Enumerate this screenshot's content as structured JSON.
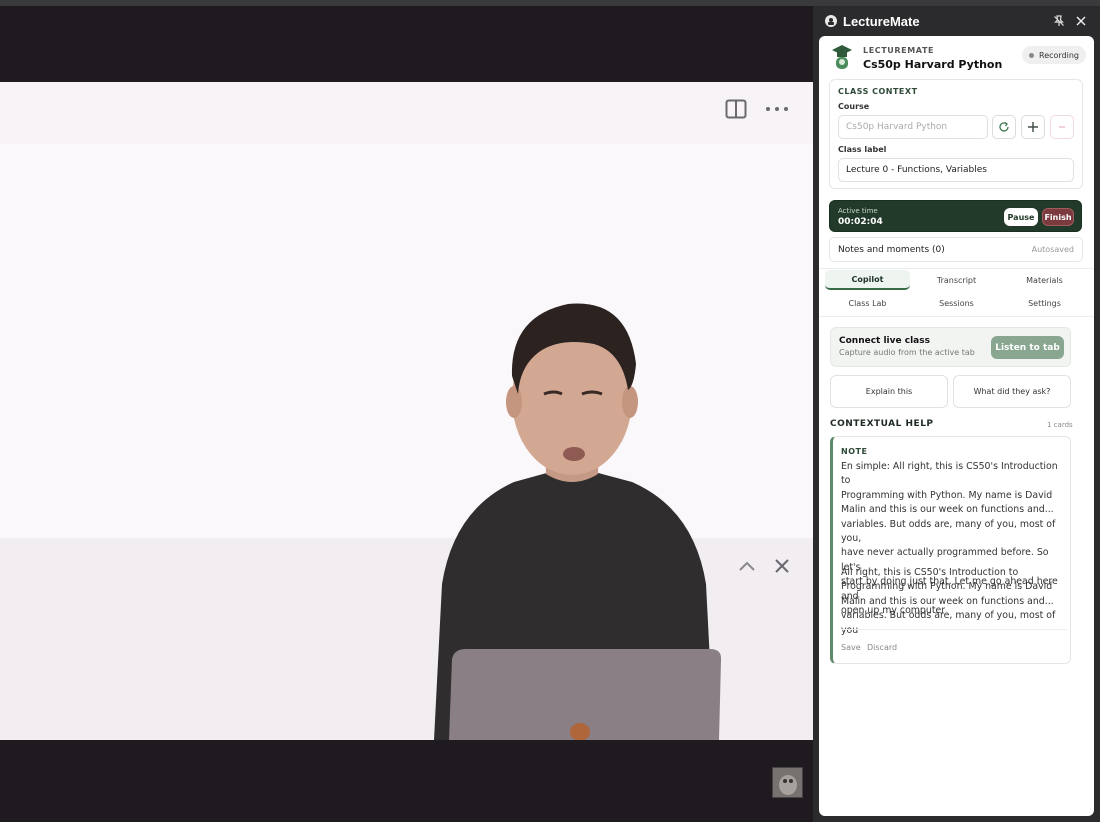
{
  "panel": {
    "app_title": "LectureMate",
    "pin_icon": "pin-off-icon",
    "close_icon": "close-icon"
  },
  "header": {
    "brand": "LECTUREMATE",
    "course_name": "Cs50p Harvard Python",
    "status": "Recording"
  },
  "class_context": {
    "section_title": "CLASS CONTEXT",
    "course_label": "Course",
    "course_placeholder": "Cs50p Harvard Python",
    "class_label_label": "Class label",
    "class_label_value": "Lecture 0 - Functions, Variables"
  },
  "timer": {
    "label": "Active time",
    "value": "00:02:04",
    "pause_label": "Pause",
    "finish_label": "Finish"
  },
  "notes": {
    "title": "Notes and moments (0)",
    "status": "Autosaved"
  },
  "tabs": [
    {
      "label": "Copilot",
      "active": true
    },
    {
      "label": "Transcript",
      "active": false
    },
    {
      "label": "Materials",
      "active": false
    },
    {
      "label": "Class Lab",
      "active": false
    },
    {
      "label": "Sessions",
      "active": false
    },
    {
      "label": "Settings",
      "active": false
    }
  ],
  "connect": {
    "title": "Connect live class",
    "subtitle": "Capture audio from the active tab",
    "button": "Listen to tab"
  },
  "quick_actions": {
    "explain": "Explain this",
    "what_asked": "What did they ask?"
  },
  "contextual_help": {
    "title": "CONTEXTUAL HELP",
    "count": "1 cards",
    "card": {
      "kind": "NOTE",
      "p1_lines": [
        "En simple: All right, this is CS50's Introduction to",
        "Programming with Python. My name is David",
        "Malin and this is our week on functions and...",
        "variables. But odds are, many of you, most of you,",
        "have never actually programmed before. So let's",
        "start by doing just that. Let me go ahead here and",
        "open up my computer"
      ],
      "p2_lines": [
        "All right, this is CS50's Introduction to",
        "Programming with Python. My name is David",
        "Malin and this is our week on functions and...",
        "variables. But odds are, many of you, most of you"
      ],
      "save": "Save",
      "discard": "Discard"
    }
  },
  "colors": {
    "accent_dark_green": "#223a2a",
    "accent_green": "#88a690",
    "finish_red": "#7a3a3e"
  }
}
